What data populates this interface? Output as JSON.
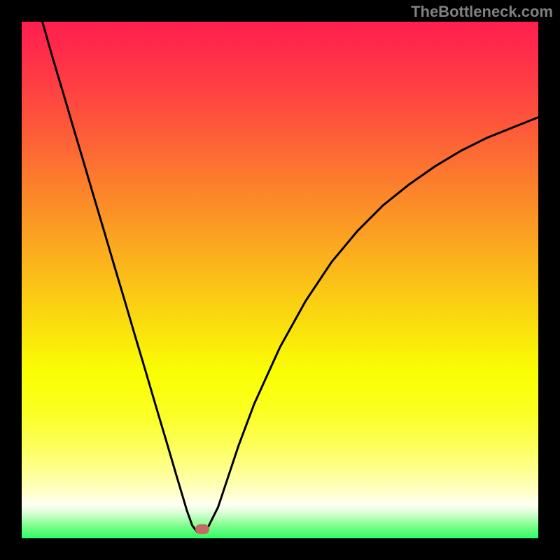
{
  "watermark": "TheBottleneck.com",
  "chart_data": {
    "type": "line",
    "title": "",
    "xlabel": "",
    "ylabel": "",
    "xlim": [
      0,
      100
    ],
    "ylim": [
      0,
      100
    ],
    "curve": {
      "x": [
        4,
        6,
        8,
        10,
        12,
        14,
        16,
        18,
        20,
        22,
        24,
        26,
        28,
        30,
        32,
        33,
        34,
        35,
        36,
        38,
        40,
        42,
        45,
        50,
        55,
        60,
        65,
        70,
        75,
        80,
        85,
        90,
        95,
        100
      ],
      "y": [
        100,
        93,
        86.3,
        79.5,
        72.8,
        66,
        59.3,
        52.5,
        45.8,
        39,
        32.3,
        25.5,
        18.8,
        12,
        5.3,
        2.5,
        1.2,
        1.2,
        2,
        6,
        12,
        18,
        26,
        37,
        46,
        53.5,
        59.5,
        64.5,
        68.5,
        72,
        75,
        77.5,
        79.5,
        81.5
      ]
    },
    "marker": {
      "x": 34.9,
      "y": 1.7
    },
    "gradient_stops": [
      {
        "pos": 0.0,
        "color": "#ff1f4f"
      },
      {
        "pos": 0.05,
        "color": "#ff2a4b"
      },
      {
        "pos": 0.12,
        "color": "#fe3e43"
      },
      {
        "pos": 0.2,
        "color": "#fd573a"
      },
      {
        "pos": 0.3,
        "color": "#fc7a2e"
      },
      {
        "pos": 0.4,
        "color": "#fb9d23"
      },
      {
        "pos": 0.5,
        "color": "#fbc018"
      },
      {
        "pos": 0.6,
        "color": "#fae30c"
      },
      {
        "pos": 0.68,
        "color": "#faff03"
      },
      {
        "pos": 0.76,
        "color": "#fbff24"
      },
      {
        "pos": 0.82,
        "color": "#fdff59"
      },
      {
        "pos": 0.87,
        "color": "#feff91"
      },
      {
        "pos": 0.91,
        "color": "#ffffc8"
      },
      {
        "pos": 0.935,
        "color": "#fffff3"
      },
      {
        "pos": 0.95,
        "color": "#dcffd7"
      },
      {
        "pos": 0.965,
        "color": "#a7feab"
      },
      {
        "pos": 0.98,
        "color": "#6ffd82"
      },
      {
        "pos": 1.0,
        "color": "#2efc68"
      }
    ]
  }
}
